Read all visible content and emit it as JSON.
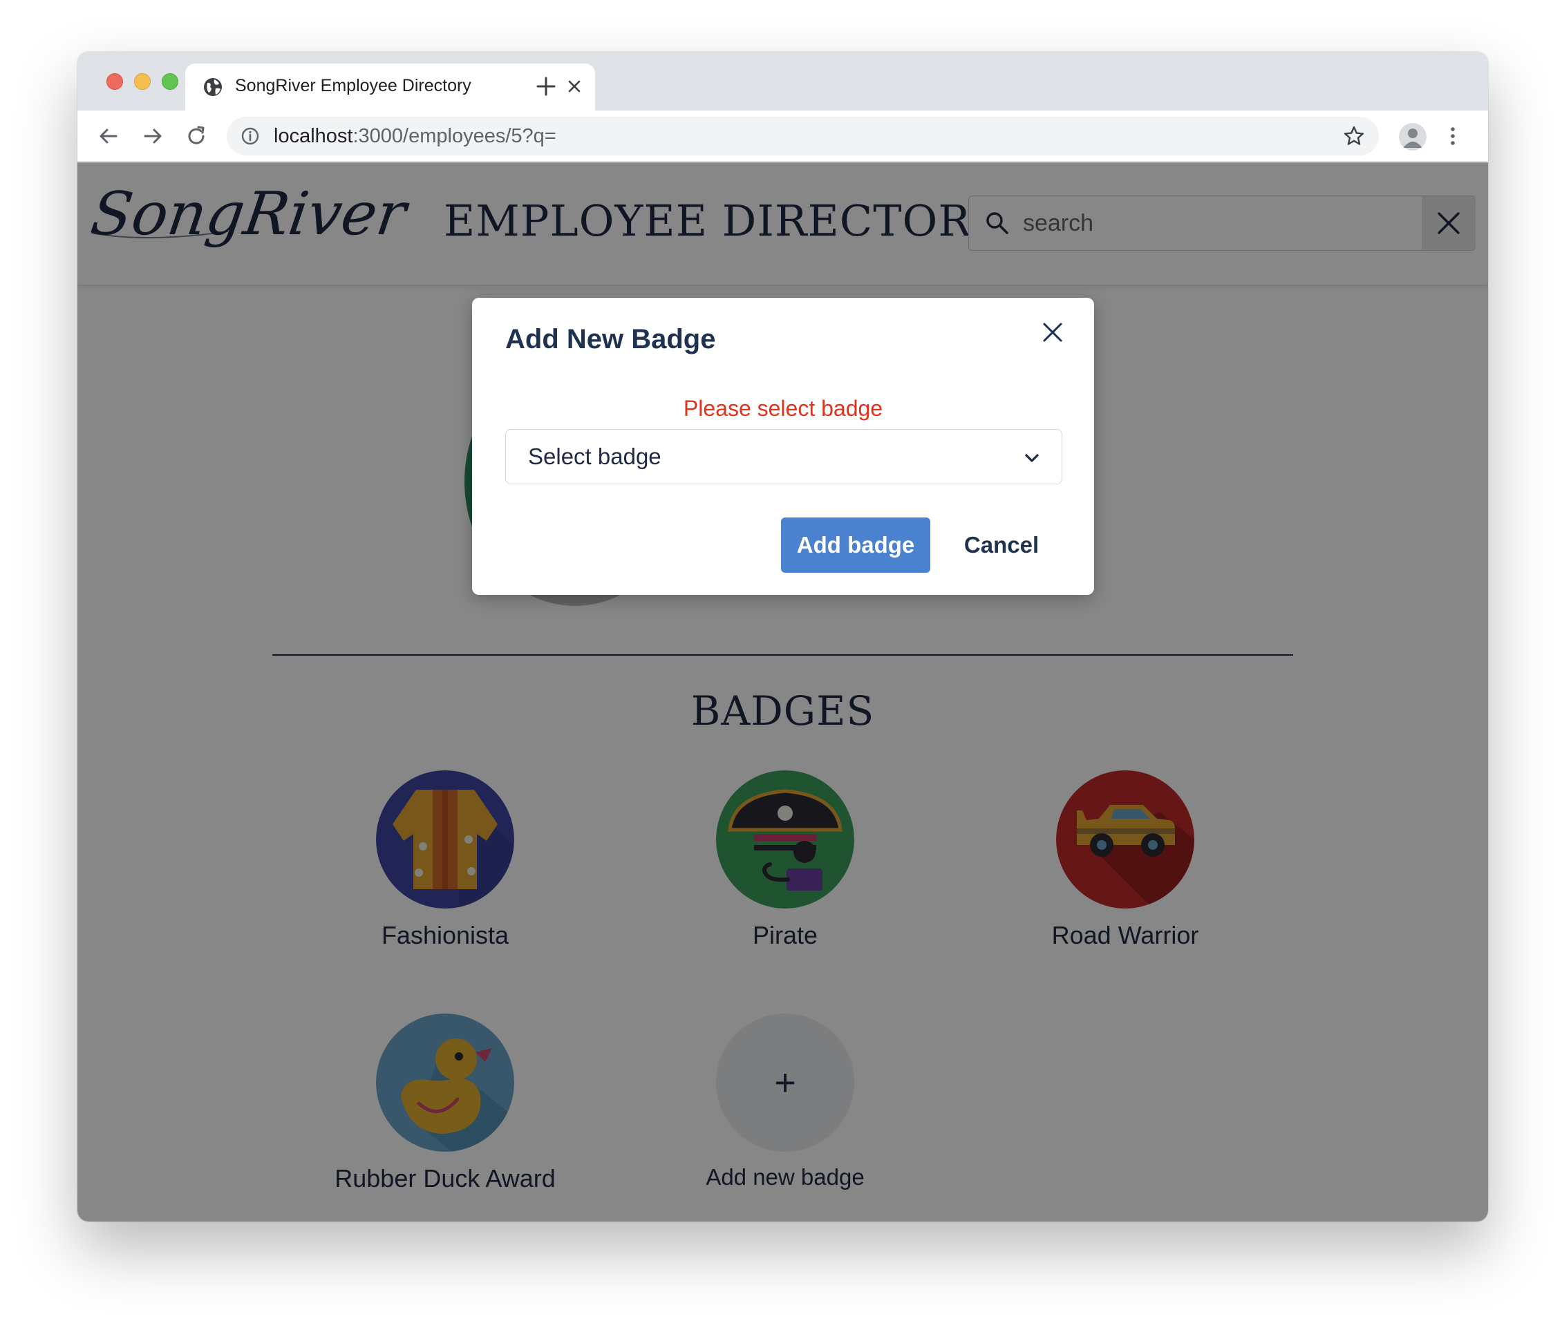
{
  "browser": {
    "tab_title": "SongRiver Employee Directory",
    "url_host": "localhost",
    "url_rest": ":3000/employees/5?q="
  },
  "header": {
    "logo_text": "SongRiver",
    "title": "EMPLOYEE DIRECTORY",
    "search_placeholder": "search"
  },
  "badges_section": {
    "title": "BADGES",
    "badges": [
      {
        "name": "Fashionista",
        "icon": "hawaiian-shirt-icon",
        "bg": "#3d47a3"
      },
      {
        "name": "Pirate",
        "icon": "pirate-icon",
        "bg": "#3e9e5c"
      },
      {
        "name": "Road Warrior",
        "icon": "car-icon",
        "bg": "#c22a2a"
      },
      {
        "name": "Rubber Duck Award",
        "icon": "rubber-duck-icon",
        "bg": "#6aa5c9"
      }
    ],
    "add_label": "Add new badge",
    "add_symbol": "+"
  },
  "modal": {
    "title": "Add New Badge",
    "error": "Please select badge",
    "select_value": "Select badge",
    "add_button": "Add badge",
    "cancel_button": "Cancel"
  },
  "colors": {
    "primary": "#4a82d0",
    "error": "#e0321c",
    "text_dark": "#1f2a44"
  }
}
